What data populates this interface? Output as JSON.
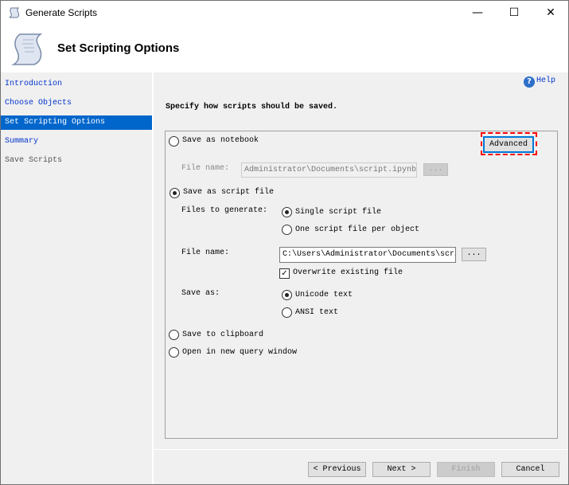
{
  "window": {
    "title": "Generate Scripts",
    "icon": "scroll-icon",
    "controls": [
      "minimize",
      "maximize",
      "close"
    ]
  },
  "header": {
    "title": "Set Scripting Options",
    "icon": "scroll-icon"
  },
  "sidebar": {
    "items": [
      {
        "label": "Introduction",
        "state": "link"
      },
      {
        "label": "Choose Objects",
        "state": "link"
      },
      {
        "label": "Set Scripting Options",
        "state": "selected"
      },
      {
        "label": "Summary",
        "state": "link"
      },
      {
        "label": "Save Scripts",
        "state": "disabled"
      }
    ]
  },
  "main": {
    "help": "Help",
    "instruction": "Specify how scripts should be saved.",
    "notebook": {
      "label": "Save as notebook",
      "checked": false,
      "file_label": "File name:",
      "file_value": "Administrator\\Documents\\script.ipynb",
      "browse": "..."
    },
    "advanced": "Advanced",
    "script_file": {
      "label": "Save as script file",
      "checked": true,
      "files_label": "Files to generate:",
      "single": "Single script file",
      "per_object": "One script file per object",
      "files_selected": "single",
      "file_label": "File name:",
      "file_value": "C:\\Users\\Administrator\\Documents\\script.sql",
      "browse": "...",
      "overwrite": "Overwrite existing file",
      "overwrite_checked": true,
      "save_as_label": "Save as:",
      "unicode": "Unicode text",
      "ansi": "ANSI text",
      "save_as_selected": "unicode"
    },
    "clipboard": "Save to clipboard",
    "query_window": "Open in new query window"
  },
  "footer": {
    "previous": "< Previous",
    "next": "Next >",
    "finish": "Finish",
    "cancel": "Cancel"
  },
  "colors": {
    "selection": "#0066cc",
    "link": "#0033cc",
    "highlight": "#ff0000"
  }
}
